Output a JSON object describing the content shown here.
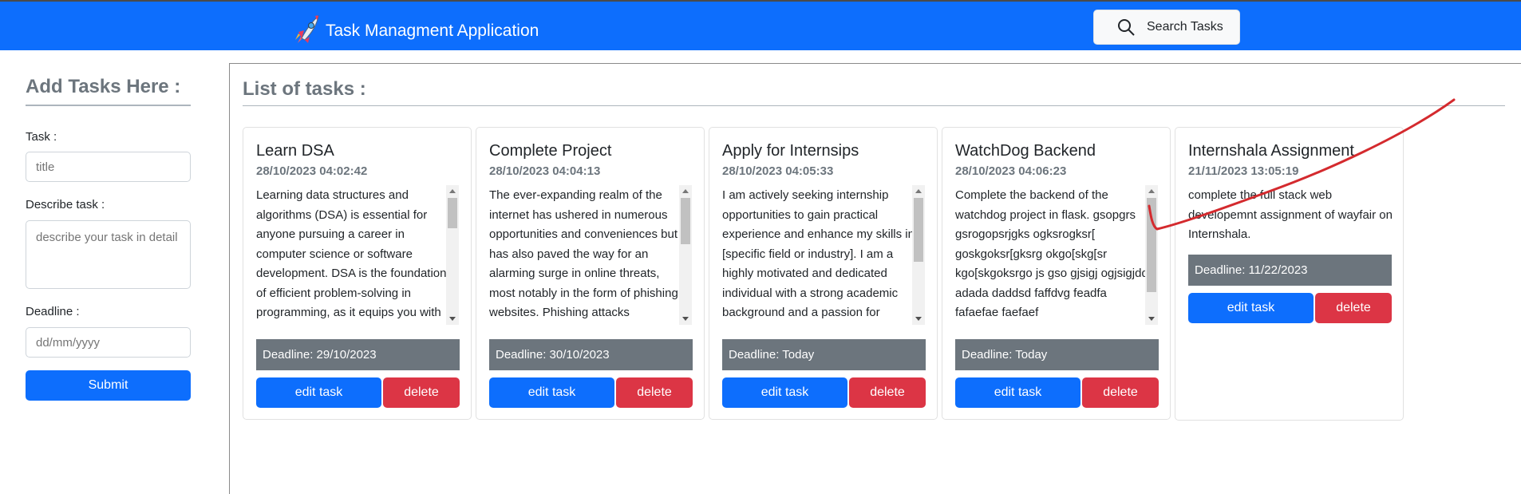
{
  "navbar": {
    "brand_text": "Task Managment Application",
    "brand_icon": "rocket-icon",
    "search_label": "Search Tasks",
    "search_icon": "search-icon",
    "color": "#0d6efd"
  },
  "sidebar": {
    "title": "Add Tasks Here :",
    "task_label": "Task :",
    "task_placeholder": "title",
    "describe_label": "Describe task :",
    "describe_placeholder": "describe your task in detail",
    "deadline_label": "Deadline :",
    "deadline_placeholder": "dd/mm/yyyy",
    "submit_label": "Submit"
  },
  "main": {
    "title": "List of tasks :",
    "tasks": [
      {
        "title": "Learn DSA",
        "date": "28/10/2023 04:02:42",
        "description": "Learning data structures and algorithms (DSA) is essential for anyone pursuing a career in computer science or software development. DSA is the foundation of efficient problem-solving in programming, as it equips you with the tools and",
        "deadline": "Deadline: 29/10/2023",
        "edit_label": "edit task",
        "delete_label": "delete"
      },
      {
        "title": "Complete Project",
        "date": "28/10/2023 04:04:13",
        "description": "The ever-expanding realm of the internet has ushered in numerous opportunities and conveniences but has also paved the way for an alarming surge in online threats, most notably in the form of phishing websites. Phishing attacks",
        "deadline": "Deadline: 30/10/2023",
        "edit_label": "edit task",
        "delete_label": "delete"
      },
      {
        "title": "Apply for Internsips",
        "date": "28/10/2023 04:05:33",
        "description": "I am actively seeking internship opportunities to gain practical experience and enhance my skills in [specific field or industry]. I am a highly motivated and dedicated individual with a strong academic background and a passion for [relevant skills or interests]. I",
        "deadline": "Deadline: Today",
        "edit_label": "edit task",
        "delete_label": "delete"
      },
      {
        "title": "WatchDog Backend",
        "date": "28/10/2023 04:06:23",
        "description": "Complete the backend of the watchdog project in flask. gsopgrs gsrogopsrjgks ogksrogksr[ goskgoksr[gksrg okgo[skg[sr kgo[skgoksrgo js gso gjsigj ogjsigjdd adada daddsd faffdvg feadfa fafaefae faefaef afeafefaefaefaefaefaefaefaefaef",
        "deadline": "Deadline: Today",
        "edit_label": "edit task",
        "delete_label": "delete"
      },
      {
        "title": "Internshala Assignment",
        "date": "21/11/2023 13:05:19",
        "description": "complete the full stack web developemnt assignment of wayfair on Internshala.",
        "deadline": "Deadline: 11/22/2023",
        "edit_label": "edit task",
        "delete_label": "delete"
      }
    ]
  },
  "colors": {
    "primary": "#0d6efd",
    "danger": "#dc3545",
    "secondary": "#6c757d",
    "annotation": "#d42a2e"
  }
}
